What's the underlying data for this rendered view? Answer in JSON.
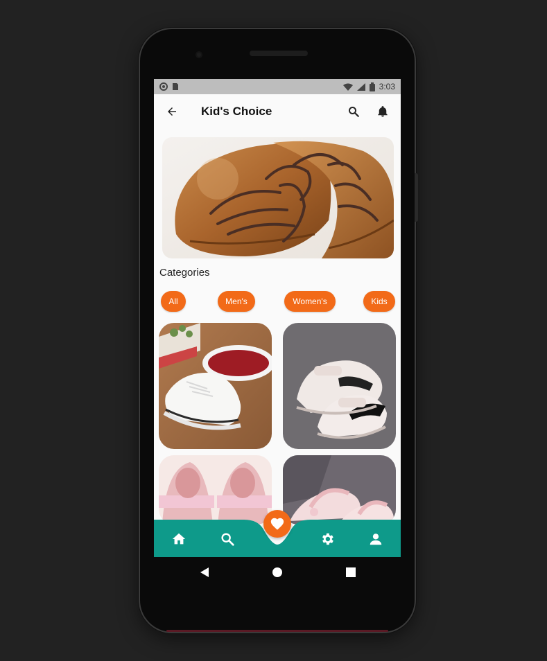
{
  "status_bar": {
    "time": "3:03",
    "left_icons": [
      "notification-dot-icon",
      "sim-icon"
    ],
    "right_icons": [
      "wifi-icon",
      "signal-icon",
      "battery-icon"
    ]
  },
  "app_bar": {
    "title": "Kid's Choice",
    "back_icon": "arrow-back-icon",
    "actions": [
      "search-icon",
      "bell-icon"
    ]
  },
  "banner": {
    "image": "brown-leather-shoes-photo"
  },
  "categories": {
    "title": "Categories",
    "chips": [
      "All",
      "Men's",
      "Women's",
      "Kids"
    ]
  },
  "products": [
    {
      "image": "white-kids-sneakers-photo"
    },
    {
      "image": "white-black-swoosh-sneakers-photo"
    },
    {
      "image": "pink-ballet-flats-photo"
    },
    {
      "image": "pink-sandals-photo"
    }
  ],
  "bottom_nav": {
    "items": [
      "home-icon",
      "search-icon",
      "favorite-heart-icon",
      "settings-gear-icon",
      "person-icon"
    ],
    "active": "favorite-heart-icon",
    "accent": "#f26a18",
    "bar_color": "#0e9a8a"
  },
  "system_nav": [
    "back-triangle-icon",
    "home-circle-icon",
    "recents-square-icon"
  ]
}
